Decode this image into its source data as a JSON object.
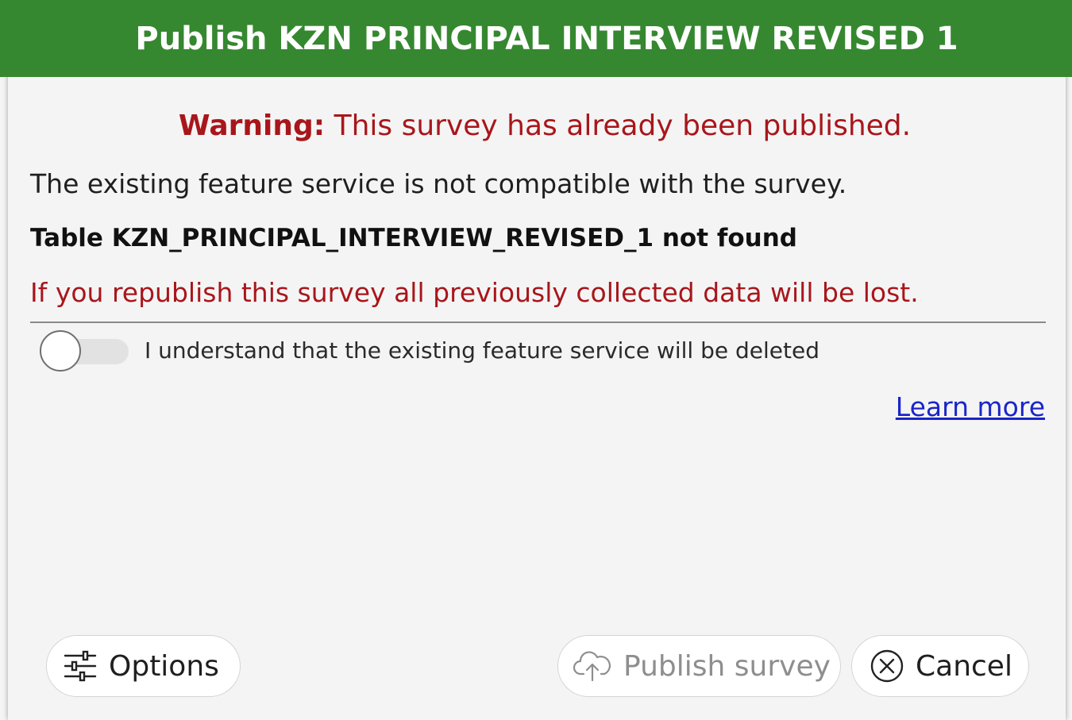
{
  "dialog": {
    "title": "Publish KZN PRINCIPAL INTERVIEW REVISED 1",
    "warning_label": "Warning:",
    "warning_text": " This survey has already been published.",
    "incompatible_text": "The existing feature service is not compatible with the survey.",
    "table_error": "Table KZN_PRINCIPAL_INTERVIEW_REVISED_1 not found",
    "data_loss_text": "If you republish this survey all previously collected data will be lost.",
    "acknowledge_label": "I understand that the existing feature service will be deleted",
    "acknowledge_checked": false,
    "learn_more": "Learn more"
  },
  "buttons": {
    "options": "Options",
    "publish": "Publish survey",
    "publish_enabled": false,
    "cancel": "Cancel"
  },
  "colors": {
    "title_bar": "#35882f",
    "warning": "#a8161b",
    "link": "#1a25c9"
  },
  "icons": {
    "options": "sliders-icon",
    "publish": "cloud-upload-icon",
    "cancel": "close-circle-icon"
  }
}
